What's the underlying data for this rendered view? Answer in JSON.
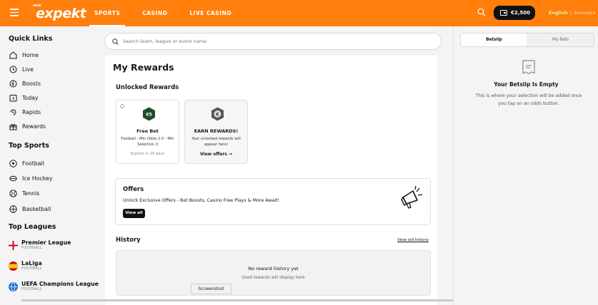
{
  "header": {
    "logo_small": "new",
    "logo_main": "expekt",
    "nav": [
      {
        "label": "SPORTS",
        "active": true
      },
      {
        "label": "CASINO",
        "active": false
      },
      {
        "label": "LIVE CASINO",
        "active": false
      }
    ],
    "balance": "€2,500",
    "lang_active": "English",
    "lang_other": "Svenska"
  },
  "sidebar": {
    "quick_links_title": "Quick Links",
    "quick_links": [
      {
        "label": "Home",
        "icon": "home-icon"
      },
      {
        "label": "Live",
        "icon": "clock-icon"
      },
      {
        "label": "Boosts",
        "icon": "boost-icon"
      },
      {
        "label": "Today",
        "icon": "calendar-icon"
      },
      {
        "label": "Rapids",
        "icon": "rapids-icon"
      },
      {
        "label": "Rewards",
        "icon": "gift-icon"
      }
    ],
    "top_sports_title": "Top Sports",
    "top_sports": [
      {
        "label": "Football",
        "icon": "football-icon"
      },
      {
        "label": "Ice Hockey",
        "icon": "ice-hockey-icon"
      },
      {
        "label": "Tennis",
        "icon": "tennis-icon"
      },
      {
        "label": "Basketball",
        "icon": "basketball-icon"
      }
    ],
    "top_leagues_title": "Top Leagues",
    "top_leagues": [
      {
        "name": "Premier League",
        "sport": "FOOTBALL",
        "flag": "england-flag-icon"
      },
      {
        "name": "LaLiga",
        "sport": "FOOTBALL",
        "flag": "spain-flag-icon"
      },
      {
        "name": "UEFA Champions League",
        "sport": "FOOTBALL",
        "flag": "globe-icon"
      }
    ]
  },
  "search": {
    "placeholder": "Search team, league or event name"
  },
  "main": {
    "title": "My Rewards",
    "unlocked_title": "Unlocked Rewards",
    "cards": [
      {
        "badge": "€5",
        "title": "Free Bet",
        "desc": "Football - Min Odds 2.0 - Min Selection 3",
        "footer": "Expires in 29 days"
      },
      {
        "badge": "€",
        "title": "EARN REWARDS!",
        "desc": "Your unlocked rewards will appear here!",
        "footer": "View offers →"
      }
    ],
    "offers": {
      "title": "Offers",
      "desc": "Unlock Exclusive Offers - Bet Boosts, Casino Free Plays & More Await!",
      "button": "View all"
    },
    "history": {
      "title": "History",
      "link": "View old history",
      "empty": "No reward history yet",
      "sub": "Used rewards will display here"
    }
  },
  "tooltip": "Screenshot",
  "betslip": {
    "tabs": [
      {
        "label": "Betslip",
        "active": true
      },
      {
        "label": "My Bets",
        "active": false
      }
    ],
    "empty_title": "Your Betslip Is Empty",
    "empty_desc": "This is where your selection will be added once you tap on an odds button."
  },
  "colors": {
    "brand": "#ff7e0c",
    "dark": "#111111",
    "badge_green": "#1e4d2b"
  }
}
